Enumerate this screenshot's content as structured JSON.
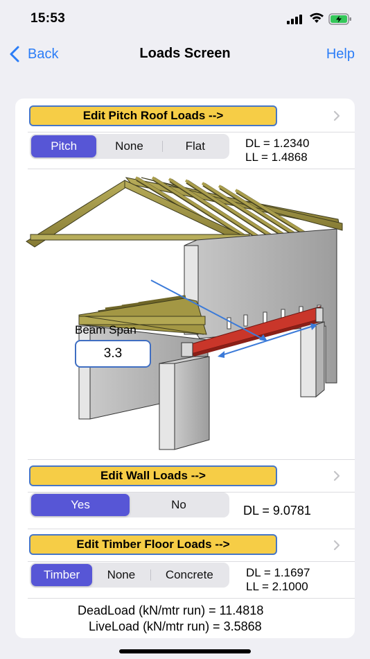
{
  "status_bar": {
    "time": "15:53"
  },
  "nav": {
    "back_label": "Back",
    "title": "Loads Screen",
    "help_label": "Help"
  },
  "roof": {
    "edit_label": "Edit Pitch Roof Loads -->",
    "options": [
      "Pitch",
      "None",
      "Flat"
    ],
    "selected": "Pitch",
    "dl": "DL = 1.2340",
    "ll": "LL = 1.4868"
  },
  "illustration": {
    "beam_span_label": "Beam Span",
    "beam_span_value": "3.3"
  },
  "wall": {
    "edit_label": "Edit Wall Loads -->",
    "options": [
      "Yes",
      "No"
    ],
    "selected": "Yes",
    "dl": "DL = 9.0781"
  },
  "floor": {
    "edit_label": "Edit Timber Floor Loads -->",
    "options": [
      "Timber",
      "None",
      "Concrete"
    ],
    "selected": "Timber",
    "dl": "DL = 1.1697",
    "ll": "LL = 2.1000"
  },
  "totals": {
    "dead_label": "DeadLoad (kN/mtr run) =",
    "dead_value": "11.4818",
    "live_label": "LiveLoad (kN/mtr run) =",
    "live_value": "3.5868"
  },
  "colors": {
    "accent": "#2b7df7",
    "segment_selected": "#5756d6",
    "edit_button": "#f6cd46",
    "beam": "#c9362a",
    "timber": "#9b8f3e"
  }
}
